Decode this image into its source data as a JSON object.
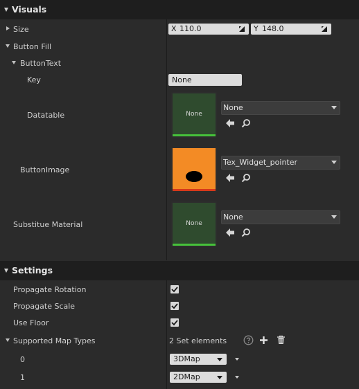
{
  "visuals": {
    "header": "Visuals",
    "size": {
      "label": "Size",
      "x_axis": "X",
      "x_value": "110.0",
      "y_axis": "Y",
      "y_value": "148.0"
    },
    "button_fill": {
      "label": "Button Fill",
      "button_text": {
        "label": "ButtonText",
        "key_label": "Key",
        "key_value": "None",
        "datatable_label": "Datatable",
        "datatable_thumb": "None",
        "datatable_combo": "None"
      },
      "button_image": {
        "label": "ButtonImage",
        "combo": "Tex_Widget_pointer"
      },
      "substitute_material": {
        "label": "Substitue Material",
        "thumb": "None",
        "combo": "None"
      }
    }
  },
  "settings": {
    "header": "Settings",
    "propagate_rotation": {
      "label": "Propagate Rotation",
      "checked": true
    },
    "propagate_scale": {
      "label": "Propagate Scale",
      "checked": true
    },
    "use_floor": {
      "label": "Use Floor",
      "checked": true
    },
    "supported_map_types": {
      "label": "Supported Map Types",
      "count_text": "2 Set elements",
      "items": [
        {
          "index": "0",
          "value": "3DMap"
        },
        {
          "index": "1",
          "value": "2DMap"
        }
      ]
    }
  },
  "colors": {
    "thumb_green": "#2f4b2e",
    "thumb_green_bar": "#46c23b",
    "thumb_orange": "#f38b25",
    "thumb_orange_bar": "#d8391a"
  }
}
